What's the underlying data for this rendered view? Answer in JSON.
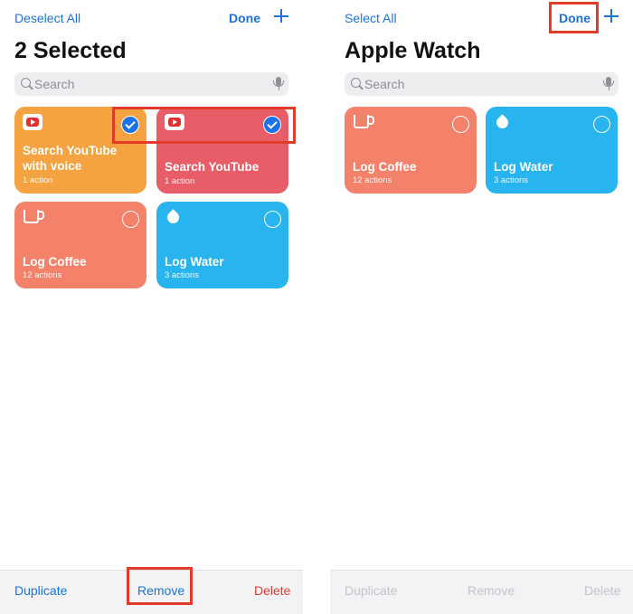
{
  "left": {
    "nav": {
      "deselect_label": "Deselect All",
      "done_label": "Done"
    },
    "title": "2 Selected",
    "search": {
      "placeholder": "Search"
    },
    "cards": [
      {
        "title": "Search YouTube with voice",
        "subtitle": "1 action",
        "icon": "youtube-icon",
        "color": "#f5a341",
        "selected": true
      },
      {
        "title": "Search YouTube",
        "subtitle": "1 action",
        "icon": "youtube-icon",
        "color": "#e85d68",
        "selected": true
      },
      {
        "title": "Log Coffee",
        "subtitle": "12 actions",
        "icon": "coffee-mug-icon",
        "color": "#f4826b",
        "selected": false
      },
      {
        "title": "Log Water",
        "subtitle": "3 actions",
        "icon": "water-drop-icon",
        "color": "#27b4ef",
        "selected": false
      }
    ],
    "bottom": {
      "duplicate_label": "Duplicate",
      "remove_label": "Remove",
      "delete_label": "Delete"
    }
  },
  "right": {
    "nav": {
      "select_label": "Select All",
      "done_label": "Done"
    },
    "title": "Apple Watch",
    "search": {
      "placeholder": "Search"
    },
    "cards": [
      {
        "title": "Log Coffee",
        "subtitle": "12 actions",
        "icon": "coffee-mug-icon",
        "color": "#f4826b",
        "selected": false
      },
      {
        "title": "Log Water",
        "subtitle": "3 actions",
        "icon": "water-drop-icon",
        "color": "#27b4ef",
        "selected": false
      }
    ],
    "bottom": {
      "duplicate_label": "Duplicate",
      "remove_label": "Remove",
      "delete_label": "Delete"
    }
  },
  "colors": {
    "accent": "#1a73d9",
    "destructive": "#e5372d",
    "highlight": "#e33a2a"
  }
}
